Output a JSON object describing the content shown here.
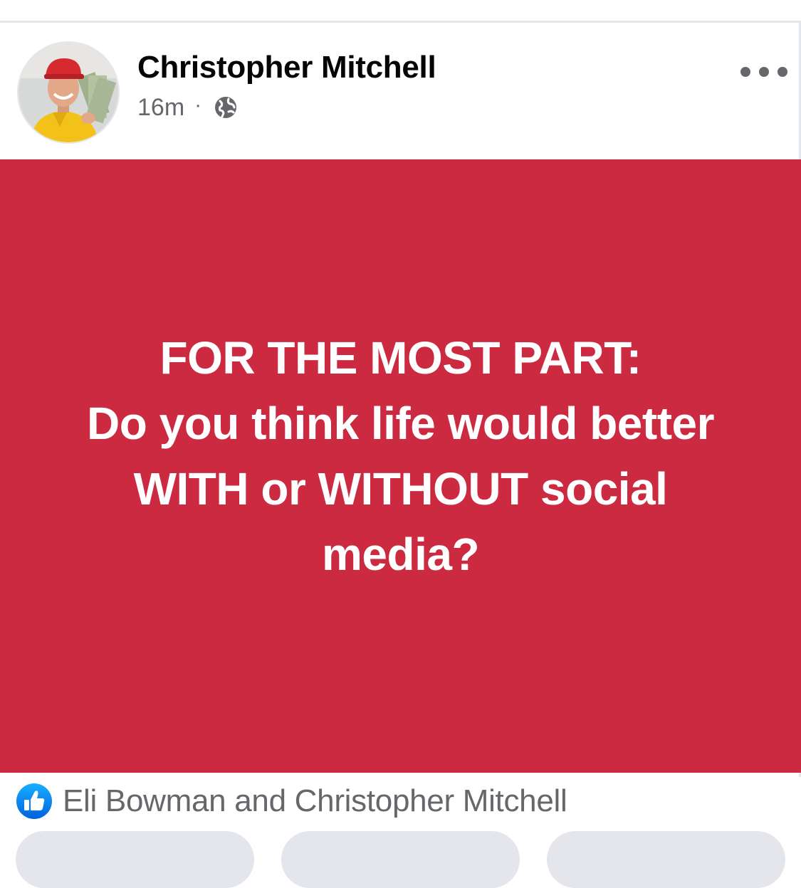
{
  "post": {
    "author_name": "Christopher Mitchell",
    "timestamp": "16m",
    "meta_separator": "·",
    "audience_icon": "globe-icon",
    "menu_icon": "more-options-icon",
    "background_color": "#cc2a41",
    "text_lines": [
      "FOR THE MOST PART:",
      "Do you think life would better",
      "WITH or WITHOUT social",
      "media?"
    ]
  },
  "reactions": {
    "icon": "like-icon",
    "text": "Eli Bowman and Christopher Mitchell"
  },
  "action_buttons": [
    {
      "name": "action-button-1"
    },
    {
      "name": "action-button-2"
    },
    {
      "name": "action-button-3"
    }
  ]
}
